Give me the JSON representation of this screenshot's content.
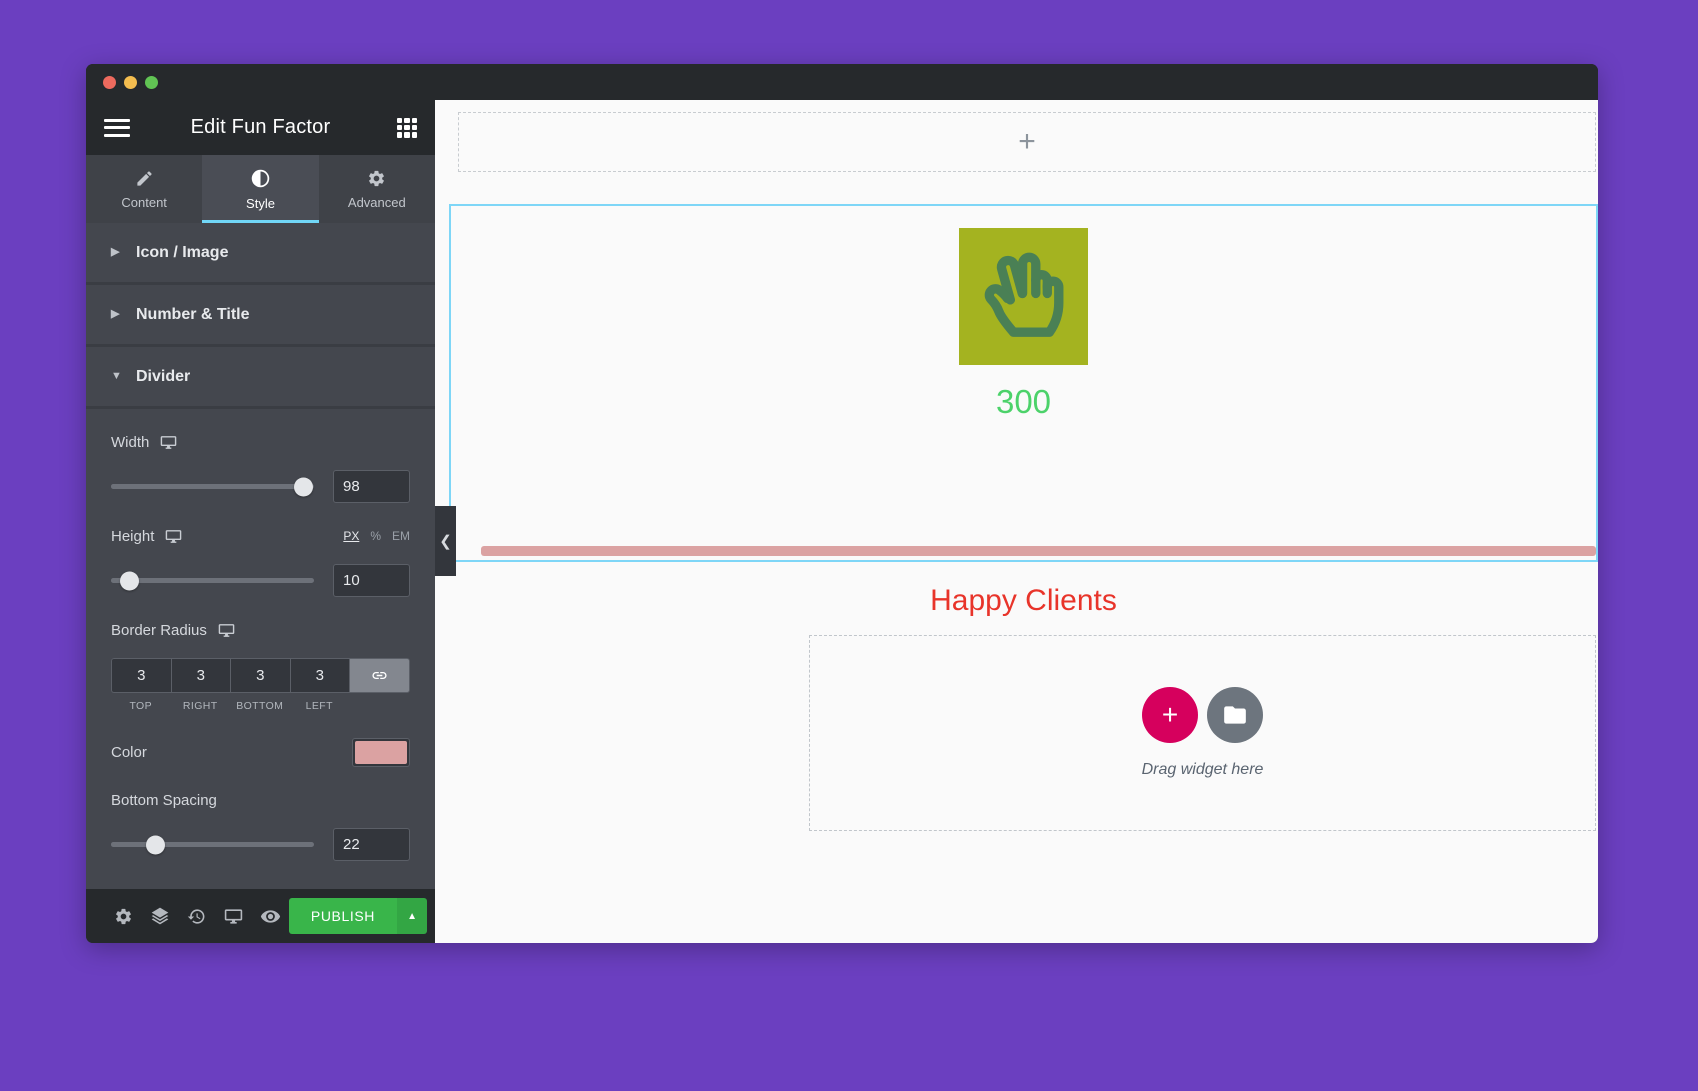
{
  "window": {
    "traffic_lights": [
      "close",
      "minimize",
      "maximize"
    ]
  },
  "panel": {
    "header": {
      "title": "Edit Fun Factor",
      "menu_icon": "hamburger-menu-icon",
      "widgets_icon": "widgets-grid-icon"
    },
    "tabs": [
      {
        "label": "Content",
        "icon": "pencil-icon",
        "active": false
      },
      {
        "label": "Style",
        "icon": "contrast-icon",
        "active": true
      },
      {
        "label": "Advanced",
        "icon": "gear-icon",
        "active": false
      }
    ],
    "sections": [
      {
        "label": "Icon / Image",
        "expanded": false,
        "arrow": "▶"
      },
      {
        "label": "Number & Title",
        "expanded": false,
        "arrow": "▶"
      },
      {
        "label": "Divider",
        "expanded": true,
        "arrow": "▼"
      }
    ],
    "divider_controls": {
      "width": {
        "label": "Width",
        "device_icon": "desktop-icon",
        "value": "98",
        "slider_percent": 95
      },
      "height": {
        "label": "Height",
        "device_icon": "desktop-icon",
        "value": "10",
        "slider_percent": 9,
        "units": [
          {
            "label": "PX",
            "active": true
          },
          {
            "label": "%",
            "active": false
          },
          {
            "label": "EM",
            "active": false
          }
        ]
      },
      "border_radius": {
        "label": "Border Radius",
        "device_icon": "desktop-icon",
        "link_icon": "link-chain-icon",
        "linked": true,
        "values": [
          {
            "value": "3",
            "label": "TOP"
          },
          {
            "value": "3",
            "label": "RIGHT"
          },
          {
            "value": "3",
            "label": "BOTTOM"
          },
          {
            "value": "3",
            "label": "LEFT"
          }
        ]
      },
      "color": {
        "label": "Color",
        "swatch_hex": "#dba2a2"
      },
      "bottom_spacing": {
        "label": "Bottom Spacing",
        "value": "22",
        "slider_percent": 22
      }
    },
    "footer": {
      "icons": [
        {
          "name": "settings-gear-icon"
        },
        {
          "name": "navigator-layers-icon"
        },
        {
          "name": "history-revisions-icon"
        },
        {
          "name": "responsive-desktop-icon"
        },
        {
          "name": "preview-eye-icon"
        }
      ],
      "publish_label": "PUBLISH",
      "publish_caret_icon": "caret-up-icon"
    }
  },
  "canvas": {
    "collapse_handle_icon": "chevron-left-icon",
    "add_section": {
      "plus_icon": "plus-icon",
      "plus_glyph": "+"
    },
    "widget": {
      "icon_name": "hand-peace-icon",
      "icon_bg_hex": "#a4b320",
      "icon_fg_hex": "#4a8055",
      "number": "300",
      "number_color_hex": "#4cd26a",
      "divider_color_hex": "#dba2a2",
      "title": "Happy Clients",
      "title_color_hex": "#e8342a"
    },
    "drop_area": {
      "add_widget_glyph": "+",
      "add_widget_icon": "plus-circle-icon",
      "add_widget_color_hex": "#d6005d",
      "template_icon": "folder-icon",
      "template_color_hex": "#6d757e",
      "hint": "Drag widget here"
    },
    "selection_color_hex": "#7ed6f7"
  }
}
